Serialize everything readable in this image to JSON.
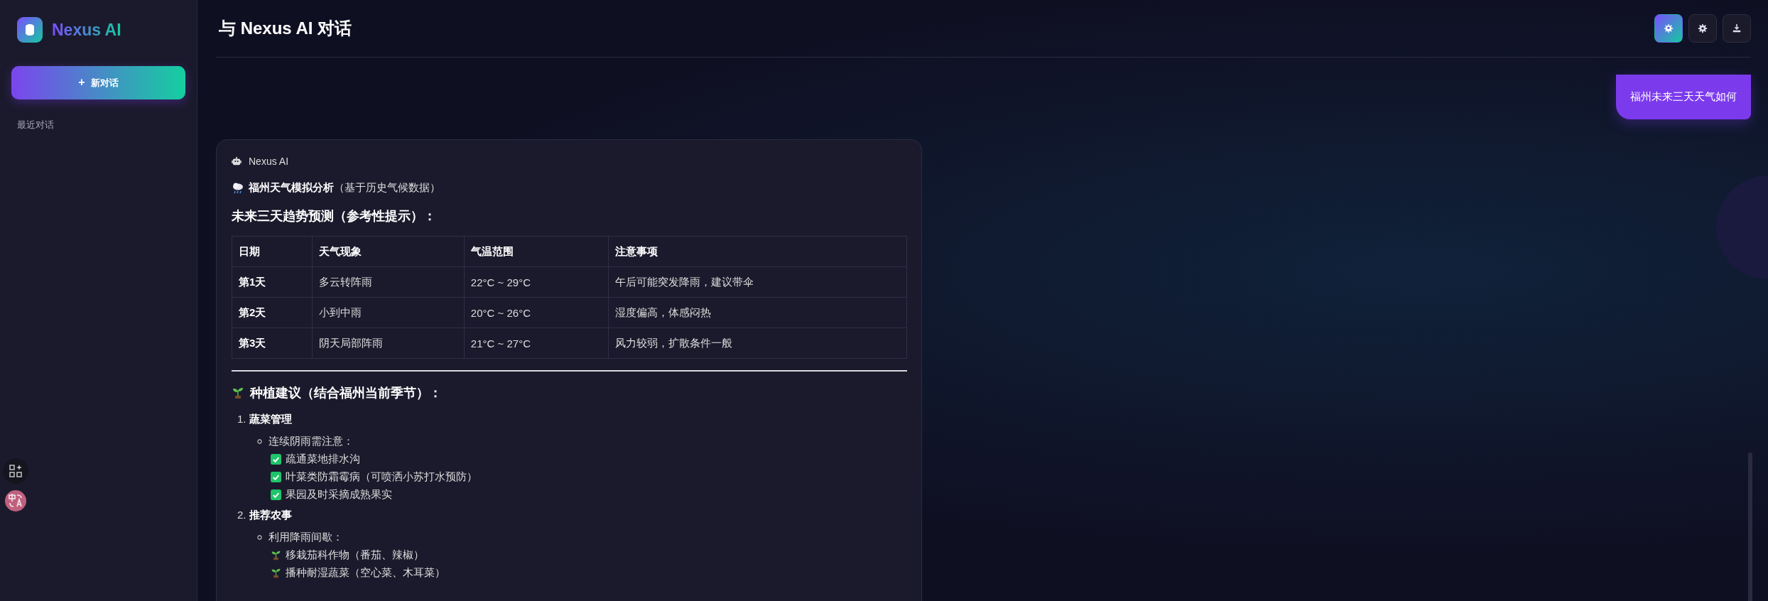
{
  "sidebar": {
    "brand": "Nexus AI",
    "new_chat_button": {
      "icon": "+",
      "label": "新对话"
    },
    "recent_heading": "最近对话"
  },
  "header": {
    "title": "与 Nexus AI 对话",
    "buttons": [
      {
        "kind": "theme",
        "selected": true
      },
      {
        "kind": "settings",
        "selected": false
      },
      {
        "kind": "download",
        "selected": false
      }
    ]
  },
  "user_message": {
    "text": "福州未来三天天气如何"
  },
  "assistant_message": {
    "sender": "Nexus AI",
    "blocks": [
      {
        "kind": "lead",
        "text": "**福州天气模拟分析**（基于历史气候数据）"
      },
      {
        "kind": "heading",
        "text": "未来三天趋势预测（参考性提示）："
      },
      {
        "kind": "table",
        "columns": [
          "日期",
          "天气现象",
          "气温范围",
          "注意事项"
        ],
        "rows": [
          [
            "第1天",
            "多云转阵雨",
            "22°C ~ 29°C",
            "午后可能突发降雨，建议带伞"
          ],
          [
            "第2天",
            "小到中雨",
            "20°C ~ 26°C",
            "湿度偏高，体感闷热"
          ],
          [
            "第3天",
            "阴天局部阵雨",
            "21°C ~ 27°C",
            "风力较弱，扩散条件一般"
          ]
        ]
      },
      {
        "kind": "rule"
      },
      {
        "kind": "section_heading",
        "text": "种植建议（结合福州当前季节）："
      },
      {
        "kind": "ordered_list",
        "items": [
          {
            "number": "1.",
            "title": "蔬菜管理",
            "bullets": [
              {
                "text": "连续阴雨需注意：",
                "subitems": [
                  {
                    "kind": "task",
                    "text": "疏通菜地排水沟"
                  },
                  {
                    "kind": "task",
                    "text": "叶菜类防霜霉病（可喷洒小苏打水预防）"
                  },
                  {
                    "kind": "task",
                    "text": "果园及时采摘成熟果实"
                  }
                ]
              }
            ]
          },
          {
            "number": "2.",
            "title": "推荐农事",
            "bullets": [
              {
                "text": "利用降雨间歇：",
                "subitems": [
                  {
                    "kind": "suggestion",
                    "text": "移栽茄科作物（番茄、辣椒）"
                  },
                  {
                    "kind": "suggestion",
                    "text": "播种耐湿蔬菜（空心菜、木耳菜）"
                  }
                ]
              }
            ]
          }
        ]
      }
    ]
  }
}
